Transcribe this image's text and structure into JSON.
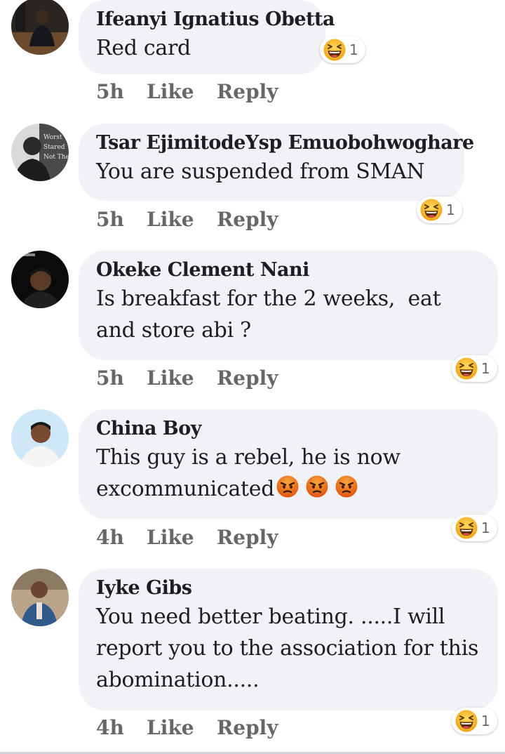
{
  "colors": {
    "bubble_bg": "#f0f2f5",
    "meta_text": "#65676b",
    "laugh_yellow": "#f7b125",
    "angry_orange": "#e9710f"
  },
  "comments": [
    {
      "author": "Ifeanyi Ignatius Obetta",
      "text": "Red card",
      "time": "5h",
      "like_label": "Like",
      "reply_label": "Reply",
      "reaction": {
        "icon": "laughing-emoji-icon",
        "count": "1"
      }
    },
    {
      "author": "Tsar EjimitodeYsp Emuobohwoghare",
      "text": "You are suspended from SMAN",
      "time": "5h",
      "like_label": "Like",
      "reply_label": "Reply",
      "reaction": {
        "icon": "laughing-emoji-icon",
        "count": "1"
      }
    },
    {
      "author": "Okeke Clement Nani",
      "text": "Is breakfast for the 2 weeks,  eat and store abi ?",
      "time": "5h",
      "like_label": "Like",
      "reply_label": "Reply",
      "reaction": {
        "icon": "laughing-emoji-icon",
        "count": "1"
      }
    },
    {
      "author": "China Boy",
      "text_line1": "This guy is a rebel, he is now",
      "text_line2": "excommunicated",
      "inline_emojis": [
        "angry-face-icon",
        "angry-face-icon",
        "angry-face-icon"
      ],
      "time": "4h",
      "like_label": "Like",
      "reply_label": "Reply",
      "reaction": {
        "icon": "laughing-emoji-icon",
        "count": "1"
      }
    },
    {
      "author": "Iyke Gibs",
      "text": "You need better beating. .....I will report you to the association for this abomination.....",
      "time": "4h",
      "like_label": "Like",
      "reply_label": "Reply",
      "reaction": {
        "icon": "laughing-emoji-icon",
        "count": "1"
      }
    }
  ]
}
